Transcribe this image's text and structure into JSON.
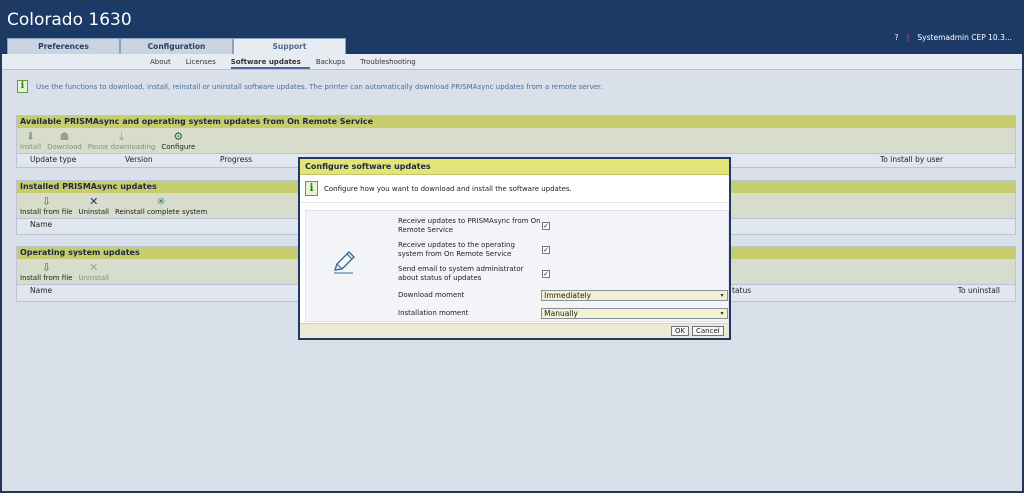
{
  "app": {
    "title": "Colorado 1630"
  },
  "user": {
    "help": "?",
    "name": "Systemadmin CEP 10.3..."
  },
  "main_tabs": [
    {
      "label": "Preferences",
      "active": false
    },
    {
      "label": "Configuration",
      "active": false
    },
    {
      "label": "Support",
      "active": true
    }
  ],
  "sub_tabs": [
    {
      "label": "About",
      "active": false
    },
    {
      "label": "Licenses",
      "active": false
    },
    {
      "label": "Software updates",
      "active": true
    },
    {
      "label": "Backups",
      "active": false
    },
    {
      "label": "Troubleshooting",
      "active": false
    }
  ],
  "info_text": "Use the functions to download, install, reinstall or uninstall software updates. The printer can automatically download PRISMAsync updates from a remote server.",
  "available": {
    "title": "Available PRISMAsync and operating system updates from On Remote Service",
    "tools": [
      {
        "label": "Install",
        "icon": "install-icon",
        "enabled": false
      },
      {
        "label": "Download",
        "icon": "download-icon",
        "enabled": false
      },
      {
        "label": "Pause downloading",
        "icon": "pause-download-icon",
        "enabled": false
      },
      {
        "label": "Configure",
        "icon": "configure-icon",
        "enabled": true
      }
    ],
    "columns": [
      "Update type",
      "Version",
      "Progress",
      "To install by user"
    ]
  },
  "installed": {
    "title": "Installed PRISMAsync updates",
    "tools": [
      {
        "label": "Install from file",
        "icon": "install-from-file-icon",
        "enabled": true
      },
      {
        "label": "Uninstall",
        "icon": "uninstall-icon",
        "enabled": true
      },
      {
        "label": "Reinstall complete system",
        "icon": "reinstall-icon",
        "enabled": true
      }
    ],
    "columns": [
      "Name"
    ]
  },
  "os_updates": {
    "title": "Operating system updates",
    "tools": [
      {
        "label": "Install from file",
        "icon": "install-from-file-icon",
        "enabled": true
      },
      {
        "label": "Uninstall",
        "icon": "uninstall-icon",
        "enabled": false
      }
    ],
    "columns": [
      "Name",
      "tatus",
      "To uninstall"
    ]
  },
  "dialog": {
    "title": "Configure software updates",
    "info": "Configure how you want to download and install the software updates.",
    "options": [
      {
        "label": "Receive updates to PRISMAsync from On Remote Service",
        "checked": true
      },
      {
        "label": "Receive updates to the operating system from On Remote Service",
        "checked": true
      },
      {
        "label": "Send email to system administrator about status of updates",
        "checked": true
      }
    ],
    "download_moment": {
      "label": "Download moment",
      "value": "Immediately"
    },
    "installation_moment": {
      "label": "Installation moment",
      "value": "Manually"
    },
    "ok": "OK",
    "cancel": "Cancel"
  }
}
